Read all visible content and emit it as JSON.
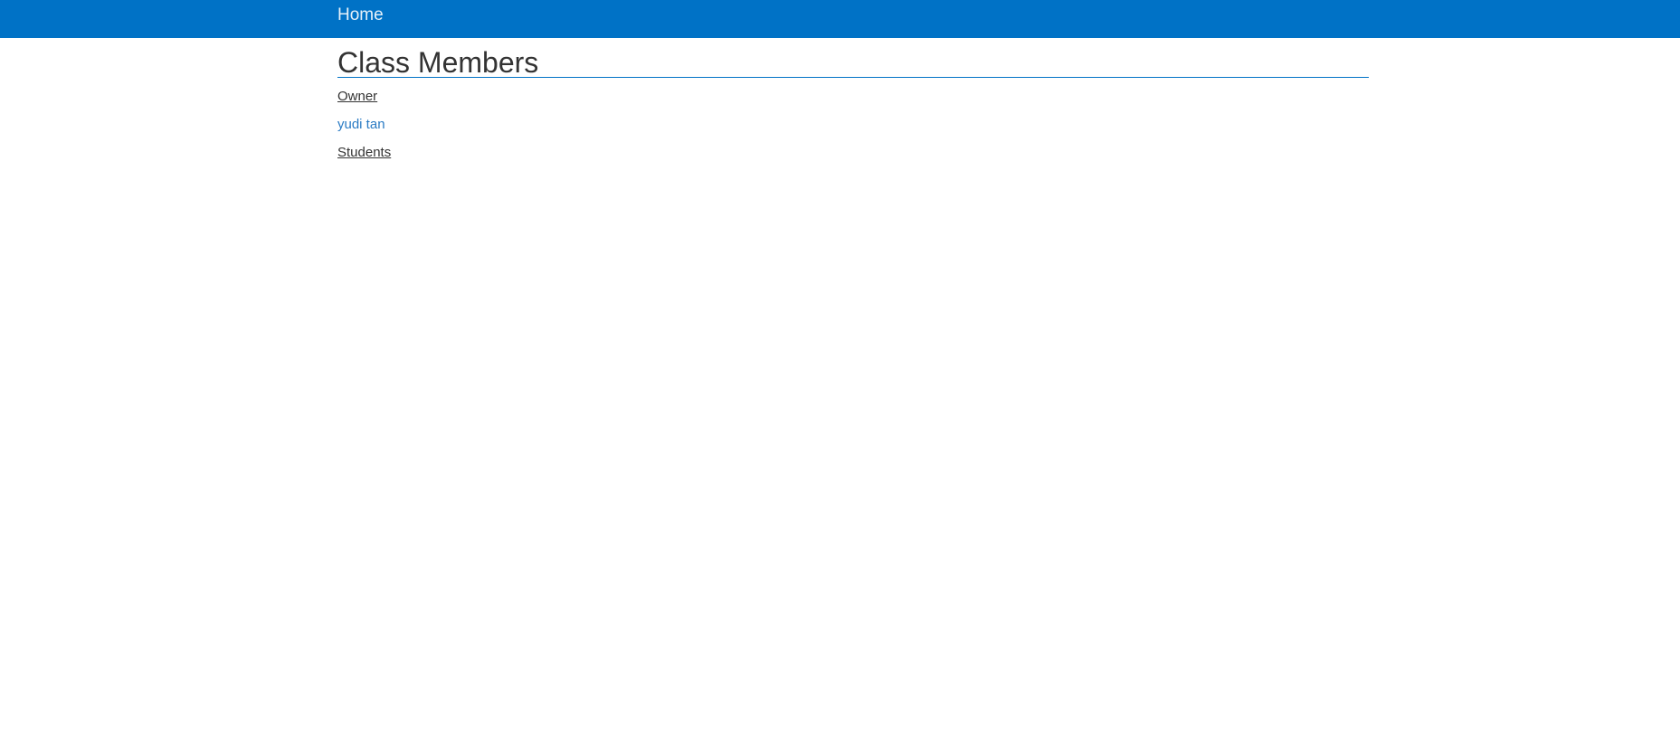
{
  "colors": {
    "navbar_bg": "#0072c6",
    "link": "#2a7bc4",
    "text": "#333333",
    "rule": "#0072c6"
  },
  "navbar": {
    "home_label": "Home"
  },
  "page": {
    "title": "Class Members"
  },
  "sections": {
    "owner_heading": "Owner",
    "owner_name": "yudi tan",
    "students_heading": "Students"
  }
}
